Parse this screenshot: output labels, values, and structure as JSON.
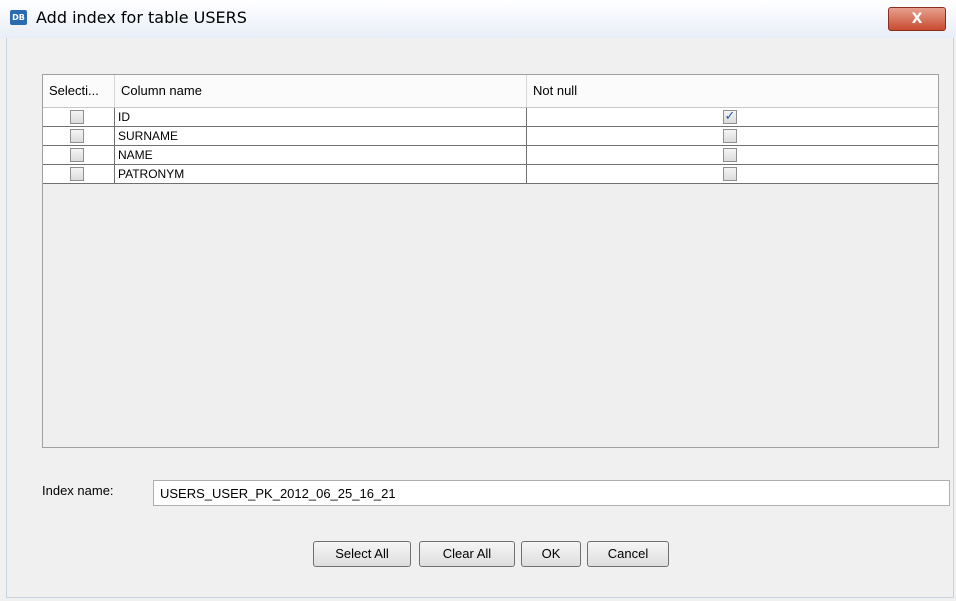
{
  "window": {
    "title": "Add index for table USERS",
    "app_icon_text": "DB",
    "close_glyph": "X"
  },
  "table": {
    "columns": [
      "Selecti...",
      "Column name",
      "Not null"
    ],
    "rows": [
      {
        "column_name": "ID",
        "selected": false,
        "not_null": true
      },
      {
        "column_name": "SURNAME",
        "selected": false,
        "not_null": false
      },
      {
        "column_name": "NAME",
        "selected": false,
        "not_null": false
      },
      {
        "column_name": "PATRONYM",
        "selected": false,
        "not_null": false
      }
    ]
  },
  "index": {
    "label": "Index name:",
    "value": "USERS_USER_PK_2012_06_25_16_21"
  },
  "buttons": {
    "select_all": "Select All",
    "clear_all": "Clear All",
    "ok": "OK",
    "cancel": "Cancel"
  },
  "colors": {
    "accent": "#2a57a8",
    "close_button": "#c84b30"
  }
}
